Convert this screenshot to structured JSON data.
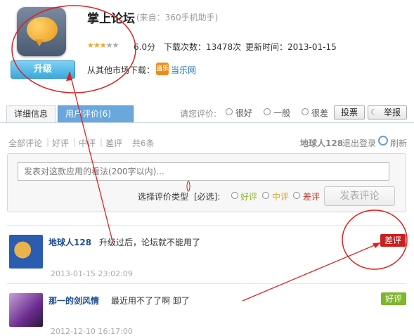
{
  "app": {
    "title": "掌上论坛",
    "source": "(来自：360手机助手)",
    "rating": "6.0分",
    "downloads": "下载次数：13478次",
    "updated": "更新时间：2013-01-15",
    "other_market_label": "从其他市场下载：",
    "market_badge": "当乐",
    "market_name": "当乐网",
    "upgrade_label": "升级",
    "stars_filled": 3,
    "stars_total": 5
  },
  "tabs": {
    "detail": "详细信息",
    "reviews": "用户评价(6)"
  },
  "rate": {
    "prompt": "请您评价:",
    "options": [
      "很好",
      "一般",
      "很差"
    ],
    "vote": "投票",
    "report": "举报"
  },
  "filters": {
    "all": "全部评论",
    "good": "好评",
    "mid": "中评",
    "bad": "差评",
    "count": "共6条",
    "sep": "|"
  },
  "user_bar": {
    "username": "地球人128",
    "logout": "退出登录",
    "refresh": "刷新"
  },
  "compose": {
    "placeholder": "发表对这款应用的看法(200字以内)...",
    "type_label": "选择评价类型",
    "required": "[必选]:",
    "good": "好评",
    "mid": "中评",
    "bad": "差评",
    "submit": "发表评论"
  },
  "reviews": [
    {
      "user": "地球人128",
      "text": "升级过后，论坛就不能用了",
      "time": "2013-01-15 23:02:09",
      "badge": "差评"
    },
    {
      "user": "那一的剑风情",
      "text": "最近用不了了啊 卸了",
      "time": "2012-12-10 16:17:00",
      "badge": "好评"
    }
  ],
  "colors": {
    "annotation": "#e02020",
    "accent": "#6aa7dd",
    "bad_badge": "#c81f1f",
    "good_badge": "#7fb52d"
  }
}
